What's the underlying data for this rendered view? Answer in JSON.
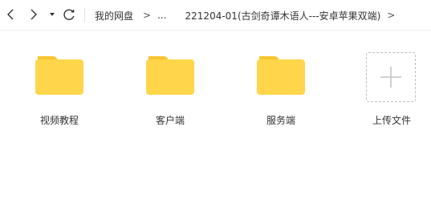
{
  "toolbar": {
    "back_icon": "chevron-left-icon",
    "forward_icon": "chevron-right-icon",
    "history_icon": "caret-down-icon",
    "refresh_icon": "refresh-icon"
  },
  "breadcrumb": {
    "items": [
      "我的网盘",
      "...",
      "221204-01(古剑奇谭木语人---安卓苹果双端)"
    ],
    "separator": ">"
  },
  "files": [
    {
      "name": "视频教程",
      "type": "folder",
      "icon": "folder-icon"
    },
    {
      "name": "客户端",
      "type": "folder",
      "icon": "folder-icon"
    },
    {
      "name": "服务端",
      "type": "folder",
      "icon": "folder-icon"
    }
  ],
  "upload": {
    "label": "上传文件",
    "icon": "plus-icon"
  },
  "colors": {
    "folder_body": "#ffd54a",
    "folder_tab": "#f7c531",
    "upload_border": "#bdbdbd",
    "icon": "#333333",
    "plus": "#c4c4c4"
  }
}
